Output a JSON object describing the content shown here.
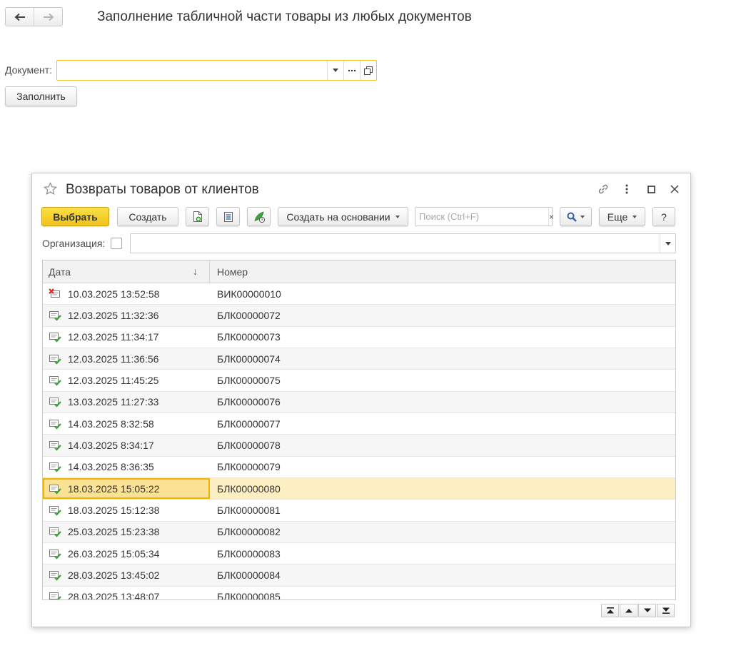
{
  "form": {
    "title": "Заполнение табличной части товары из любых документов",
    "nav": {
      "back_icon": "arrow-left-icon",
      "forward_icon": "arrow-right-icon"
    },
    "document_label": "Документ:",
    "document_value": "",
    "fill_button": "Заполнить"
  },
  "modal": {
    "title": "Возвраты товаров от клиентов",
    "toolbar": {
      "select": "Выбрать",
      "create": "Создать",
      "create_based_on": "Создать на основании",
      "search_placeholder": "Поиск (Ctrl+F)",
      "search_clear": "×",
      "more": "Еще",
      "help": "?"
    },
    "organization_label": "Организация:",
    "organization_value": "",
    "columns": {
      "date": "Дата",
      "number": "Номер"
    },
    "rows": [
      {
        "date": "10.03.2025 13:52:58",
        "number": "ВИК00000010",
        "status": "deleted"
      },
      {
        "date": "12.03.2025 11:32:36",
        "number": "БЛК00000072",
        "status": "posted"
      },
      {
        "date": "12.03.2025 11:34:17",
        "number": "БЛК00000073",
        "status": "posted"
      },
      {
        "date": "12.03.2025 11:36:56",
        "number": "БЛК00000074",
        "status": "posted"
      },
      {
        "date": "12.03.2025 11:45:25",
        "number": "БЛК00000075",
        "status": "posted"
      },
      {
        "date": "13.03.2025 11:27:33",
        "number": "БЛК00000076",
        "status": "posted"
      },
      {
        "date": "14.03.2025 8:32:58",
        "number": "БЛК00000077",
        "status": "posted"
      },
      {
        "date": "14.03.2025 8:34:17",
        "number": "БЛК00000078",
        "status": "posted"
      },
      {
        "date": "14.03.2025 8:36:35",
        "number": "БЛК00000079",
        "status": "posted"
      },
      {
        "date": "18.03.2025 15:05:22",
        "number": "БЛК00000080",
        "status": "posted",
        "selected": true
      },
      {
        "date": "18.03.2025 15:12:38",
        "number": "БЛК00000081",
        "status": "posted"
      },
      {
        "date": "25.03.2025 15:23:38",
        "number": "БЛК00000082",
        "status": "posted"
      },
      {
        "date": "26.03.2025 15:05:34",
        "number": "БЛК00000083",
        "status": "posted"
      },
      {
        "date": "28.03.2025 13:45:02",
        "number": "БЛК00000084",
        "status": "posted"
      },
      {
        "date": "28.03.2025 13:48:07",
        "number": "БЛК00000085",
        "status": "posted"
      }
    ]
  },
  "colors": {
    "accent_yellow": "#f0c21c",
    "field_focus_border": "#f0c322",
    "selected_row": "#fcefc3",
    "selected_cell": "#fbe295",
    "posted_check": "#3aa53a",
    "deleted_mark": "#d9231f"
  }
}
